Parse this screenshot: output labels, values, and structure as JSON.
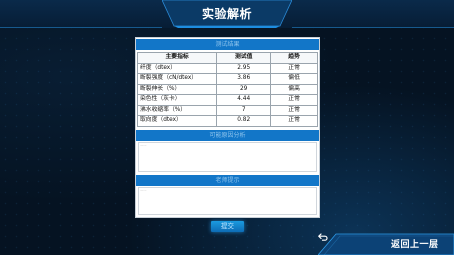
{
  "header": {
    "title": "实验解析"
  },
  "sections": {
    "results_title": "测试结果",
    "reasons_title": "可能原因分析",
    "suggestions_title": "老师提示"
  },
  "table": {
    "headers": [
      "主要指标",
      "测试值",
      "趋势"
    ],
    "rows": [
      {
        "metric": "纤度（dtex）",
        "value": "2.95",
        "trend": "正常"
      },
      {
        "metric": "断裂强度（cN/dtex）",
        "value": "3.86",
        "trend": "偏低"
      },
      {
        "metric": "断裂伸长（%）",
        "value": "29",
        "trend": "偏高"
      },
      {
        "metric": "染色性（灰卡）",
        "value": "4.44",
        "trend": "正常"
      },
      {
        "metric": "沸水收缩率（%）",
        "value": "7",
        "trend": "正常"
      },
      {
        "metric": "取向度（dtex）",
        "value": "0.82",
        "trend": "正常"
      }
    ]
  },
  "reasons_input": {
    "placeholder": "........"
  },
  "suggestions_input": {
    "placeholder": "........"
  },
  "actions": {
    "submit_label": "提交",
    "back_label": "返回上一层"
  },
  "colors": {
    "accent": "#1276c8",
    "background": "#051322"
  },
  "icons": {
    "back": "return-arrow-icon"
  }
}
